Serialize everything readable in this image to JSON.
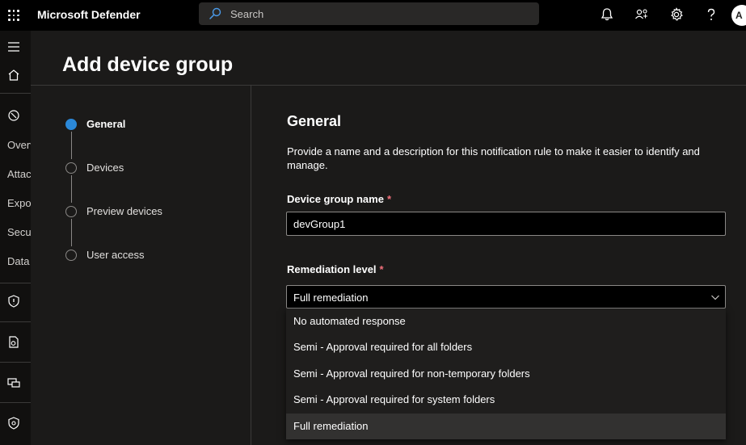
{
  "app": {
    "title": "Microsoft Defender",
    "search_placeholder": "Search",
    "avatar_initial": "A"
  },
  "nav": {
    "truncated_items": [
      "Overv",
      "Attac",
      "Expo",
      "Secur",
      "Data"
    ]
  },
  "page": {
    "title": "Add device group"
  },
  "steps": [
    {
      "label": "General",
      "active": true
    },
    {
      "label": "Devices",
      "active": false
    },
    {
      "label": "Preview devices",
      "active": false
    },
    {
      "label": "User access",
      "active": false
    }
  ],
  "form": {
    "section_title": "General",
    "description": "Provide a name and a description for this notification rule to make it easier to identify and manage.",
    "name_label": "Device group name",
    "name_value": "devGroup1",
    "remediation_label": "Remediation level",
    "required_mark": "*",
    "remediation_value": "Full remediation",
    "options": [
      "No automated response",
      "Semi - Approval required for all folders",
      "Semi - Approval required for non-temporary folders",
      "Semi - Approval required for system folders",
      "Full remediation"
    ]
  },
  "colors": {
    "accent": "#2b88d8",
    "required": "#f1707b",
    "background": "#1b1a19",
    "topbar": "#000000"
  },
  "icons": [
    "waffle-icon",
    "search-icon",
    "bell-icon",
    "share-icon",
    "gear-icon",
    "help-icon",
    "hamburger-icon",
    "home-icon",
    "incidents-icon",
    "shield-icon",
    "hunting-icon",
    "devices-icon",
    "settings-shield-icon",
    "chevron-down-icon"
  ]
}
